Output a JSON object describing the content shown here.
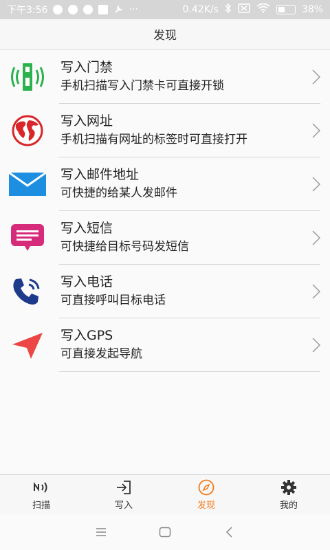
{
  "status_bar": {
    "time": "下午3:56",
    "dots": "···",
    "speed": "0.42K/s",
    "battery": "38%"
  },
  "header": {
    "title": "发现"
  },
  "items": [
    {
      "title": "写入门禁",
      "subtitle": "手机扫描写入门禁卡可直接开锁",
      "icon": "access-card-icon",
      "color": "#2bb24c"
    },
    {
      "title": "写入网址",
      "subtitle": "手机扫描有网址的标签时可直接打开",
      "icon": "globe-icon",
      "color": "#d9262a"
    },
    {
      "title": "写入邮件地址",
      "subtitle": "可快捷的给某人发邮件",
      "icon": "mail-icon",
      "color": "#1e8fe0"
    },
    {
      "title": "写入短信",
      "subtitle": "可快捷给目标号码发短信",
      "icon": "sms-icon",
      "color": "#d52b7a"
    },
    {
      "title": "写入电话",
      "subtitle": "可直接呼叫目标电话",
      "icon": "phone-icon",
      "color": "#1e3a8a"
    },
    {
      "title": "写入GPS",
      "subtitle": "可直接发起导航",
      "icon": "navigation-icon",
      "color": "#ec4646"
    }
  ],
  "tabs": [
    {
      "label": "扫描",
      "icon": "nfc-icon",
      "active": false
    },
    {
      "label": "写入",
      "icon": "write-icon",
      "active": false
    },
    {
      "label": "发现",
      "icon": "compass-icon",
      "active": true
    },
    {
      "label": "我的",
      "icon": "gear-icon",
      "active": false
    }
  ],
  "accent": "#f07a1a"
}
